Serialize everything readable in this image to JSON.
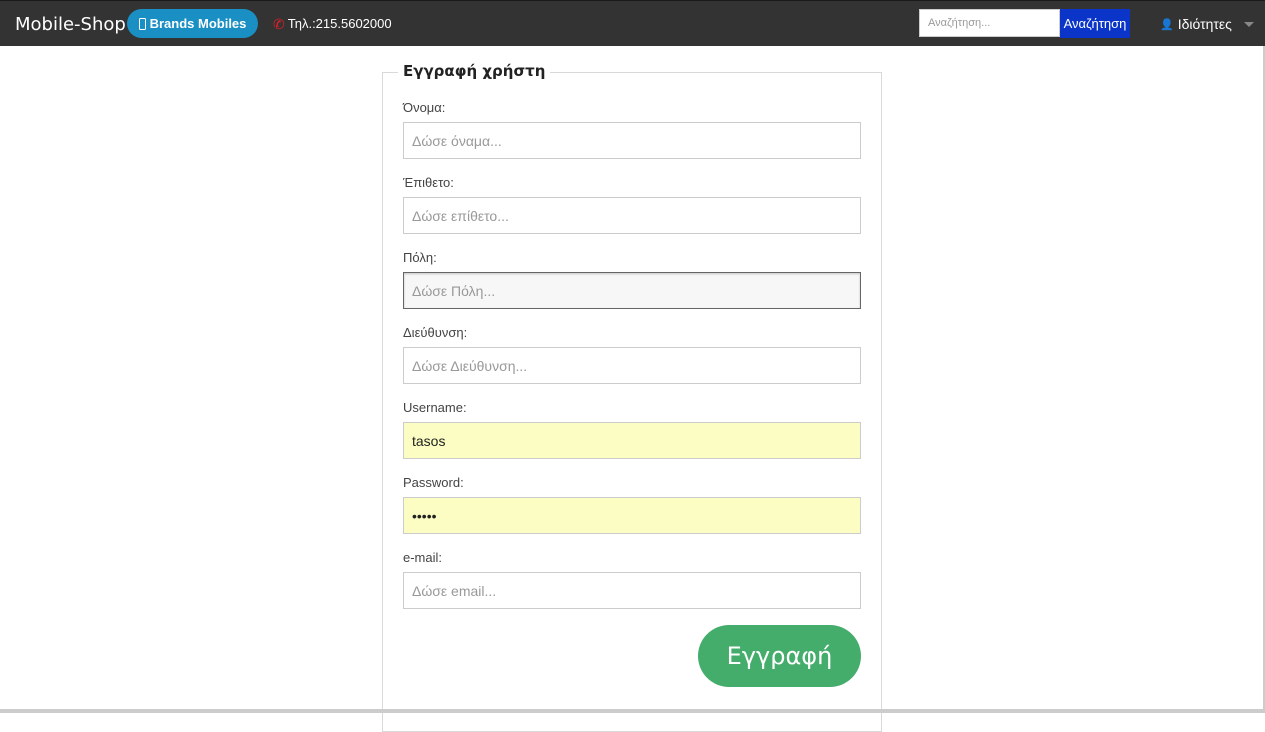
{
  "navbar": {
    "brand": "Mobile-Shop",
    "brands_button": "Brands Mobiles",
    "phone_text": "Τηλ.:215.5602000",
    "search_placeholder": "Αναζήτηση...",
    "search_button": "Αναζήτηση",
    "user_menu": "Ιδιότητες",
    "colors": {
      "bar": "#333333",
      "brands": "#1a8fc4",
      "search_button": "#0a35c8",
      "phone_icon": "#e0202a"
    }
  },
  "form": {
    "legend": "Εγγραφή χρήστη",
    "fields": [
      {
        "label": "Όνομα:",
        "placeholder": "Δώσε όναμα...",
        "value": ""
      },
      {
        "label": "Έπιθετο:",
        "placeholder": "Δώσε επίθετο...",
        "value": ""
      },
      {
        "label": "Πόλη:",
        "placeholder": "Δώσε Πόλη...",
        "value": ""
      },
      {
        "label": "Διεύθυνση:",
        "placeholder": "Δώσε Διεύθυνση...",
        "value": ""
      },
      {
        "label": "Username:",
        "placeholder": "",
        "value": "tasos"
      },
      {
        "label": "Password:",
        "placeholder": "",
        "value": "•••••"
      },
      {
        "label": "e-mail:",
        "placeholder": "Δώσε email...",
        "value": ""
      }
    ],
    "submit": "Εγγραφή",
    "colors": {
      "submit": "#44ad6b",
      "autofill": "#fbfdc2"
    }
  }
}
